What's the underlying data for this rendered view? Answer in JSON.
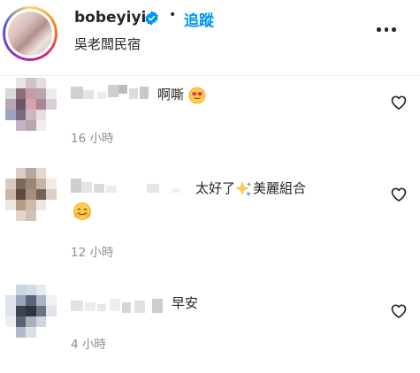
{
  "header": {
    "username": "bobeyiyi",
    "separator": "•",
    "follow_label": "追蹤",
    "subtitle": "吳老闆民宿",
    "avatar_icon": "profile-avatar",
    "verified_icon": "verified-badge-icon",
    "more_icon": "more-options-icon",
    "colors": {
      "follow": "#0095f6",
      "verified": "#0095f6",
      "text": "#262626",
      "muted": "#8e8e8e"
    }
  },
  "comments": [
    {
      "text": "啊嘶",
      "emoji": "heart-eyes-emoji",
      "time": "16 小時",
      "like_icon": "heart-icon"
    },
    {
      "text": "太好了",
      "text_after": "美麗組合",
      "emoji": "sparkles-emoji",
      "emoji2": "smiling-face-emoji",
      "time": "12 小時",
      "like_icon": "heart-icon"
    },
    {
      "text": "早安",
      "time": "4 小時",
      "like_icon": "heart-icon"
    }
  ]
}
